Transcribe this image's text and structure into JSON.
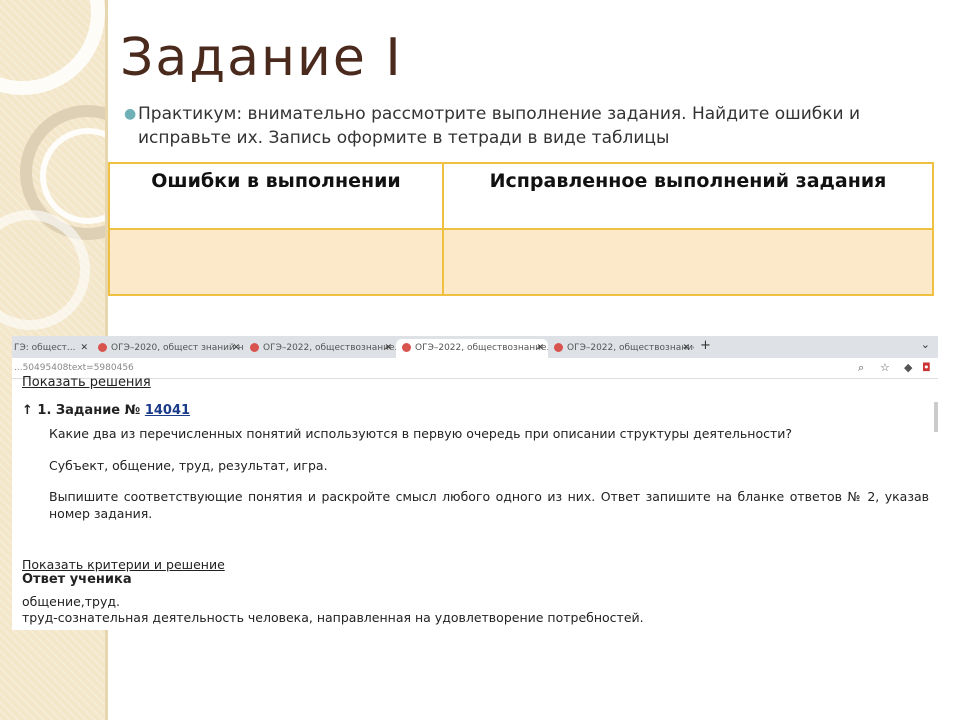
{
  "slide": {
    "title": "Задание I",
    "bullet": "Практикум: внимательно рассмотрите выполнение задания. Найдите ошибки и исправьте их. Запись оформите в тетради в виде таблицы"
  },
  "table": {
    "headers": [
      "Ошибки в выполнении",
      "Исправленное выполнений задания"
    ]
  },
  "browser": {
    "tabs": [
      {
        "label": "ГЭ: общест..."
      },
      {
        "label": "ОГЭ–2020, общест знаний на..."
      },
      {
        "label": "ОГЭ–2022, обществознание..."
      },
      {
        "label": "ОГЭ–2022, обществознание..."
      },
      {
        "label": "ОГЭ–2022, обществознание..."
      }
    ],
    "url": "...50495408text=5980456"
  },
  "page": {
    "show_solutions": "Показать решения",
    "task_prefix": "↑ 1. Задание №",
    "task_number": "14041",
    "question": "Какие два из перечисленных понятий используются в первую очередь при описании структуры деятельности?",
    "terms": "Субъект, общение, труд, результат, игра.",
    "instruction": "Выпишите соответствующие понятия и раскройте смысл любого одного из них. Ответ запишите на бланке ответов № 2, указав номер задания.",
    "criteria_link": "Показать критерии и решение",
    "student_answer_heading": "Ответ ученика",
    "answer_line1": "общение,труд.",
    "answer_line2": "труд-сознательная деятельность человека, направленная на удовлетворение потребностей."
  },
  "colors": {
    "title": "#4a2a1c",
    "table_border": "#f0c040",
    "table_fill": "#fbe9c9",
    "side_band": "#f3e6c9",
    "bullet_dot": "#6fb0b6"
  }
}
